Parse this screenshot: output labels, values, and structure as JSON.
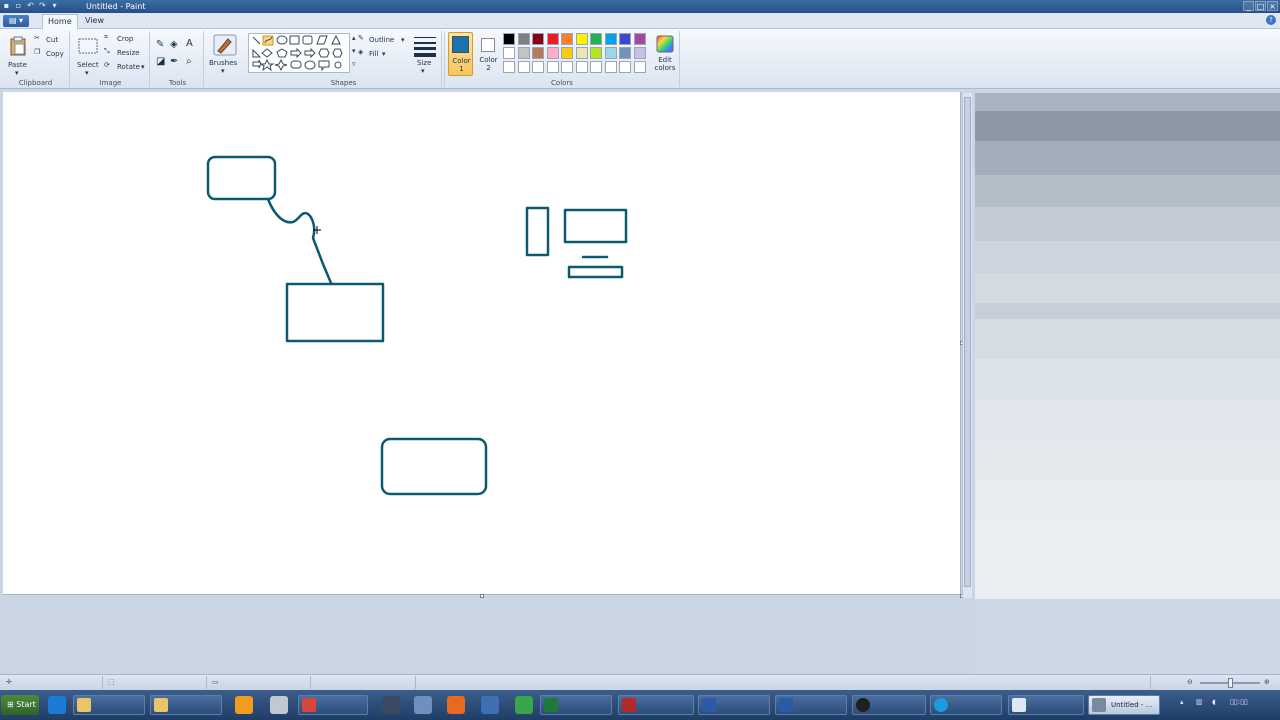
{
  "window": {
    "title": "Untitled - Paint"
  },
  "ribbon": {
    "tabs": [
      {
        "label": "Home",
        "active": true
      },
      {
        "label": "View",
        "active": false
      }
    ],
    "clipboard": {
      "group_label": "Clipboard",
      "paste_label": "Paste",
      "cut_label": "Cut",
      "copy_label": "Copy"
    },
    "image": {
      "group_label": "Image",
      "select_label": "Select",
      "crop_label": "Crop",
      "resize_label": "Resize",
      "rotate_label": "Rotate"
    },
    "tools": {
      "group_label": "Tools"
    },
    "brushes": {
      "label": "Brushes"
    },
    "shapes": {
      "group_label": "Shapes",
      "outline_label": "Outline",
      "fill_label": "Fill"
    },
    "size": {
      "label": "Size"
    },
    "colors": {
      "group_label": "Colors",
      "color1_label": "Color 1",
      "color2_label": "Color 2",
      "edit_colors_label": "Edit colors",
      "color1": "#1a74b0",
      "color2": "#ffffff",
      "drawing_color": "#0b5a70",
      "palette_row1": [
        "#000000",
        "#7f7f7f",
        "#880015",
        "#ed1c24",
        "#ff7f27",
        "#fff200",
        "#22b14c",
        "#00a2e8",
        "#3f48cc",
        "#a349a4"
      ],
      "palette_row2": [
        "#ffffff",
        "#c3c3c3",
        "#b97a57",
        "#ffaec9",
        "#ffc90e",
        "#efe4b0",
        "#b5e61d",
        "#99d9ea",
        "#7092be",
        "#c8bfe7"
      ]
    }
  },
  "taskbar": {
    "start_label": "Start",
    "active_task_label": "Untitled - ..."
  }
}
